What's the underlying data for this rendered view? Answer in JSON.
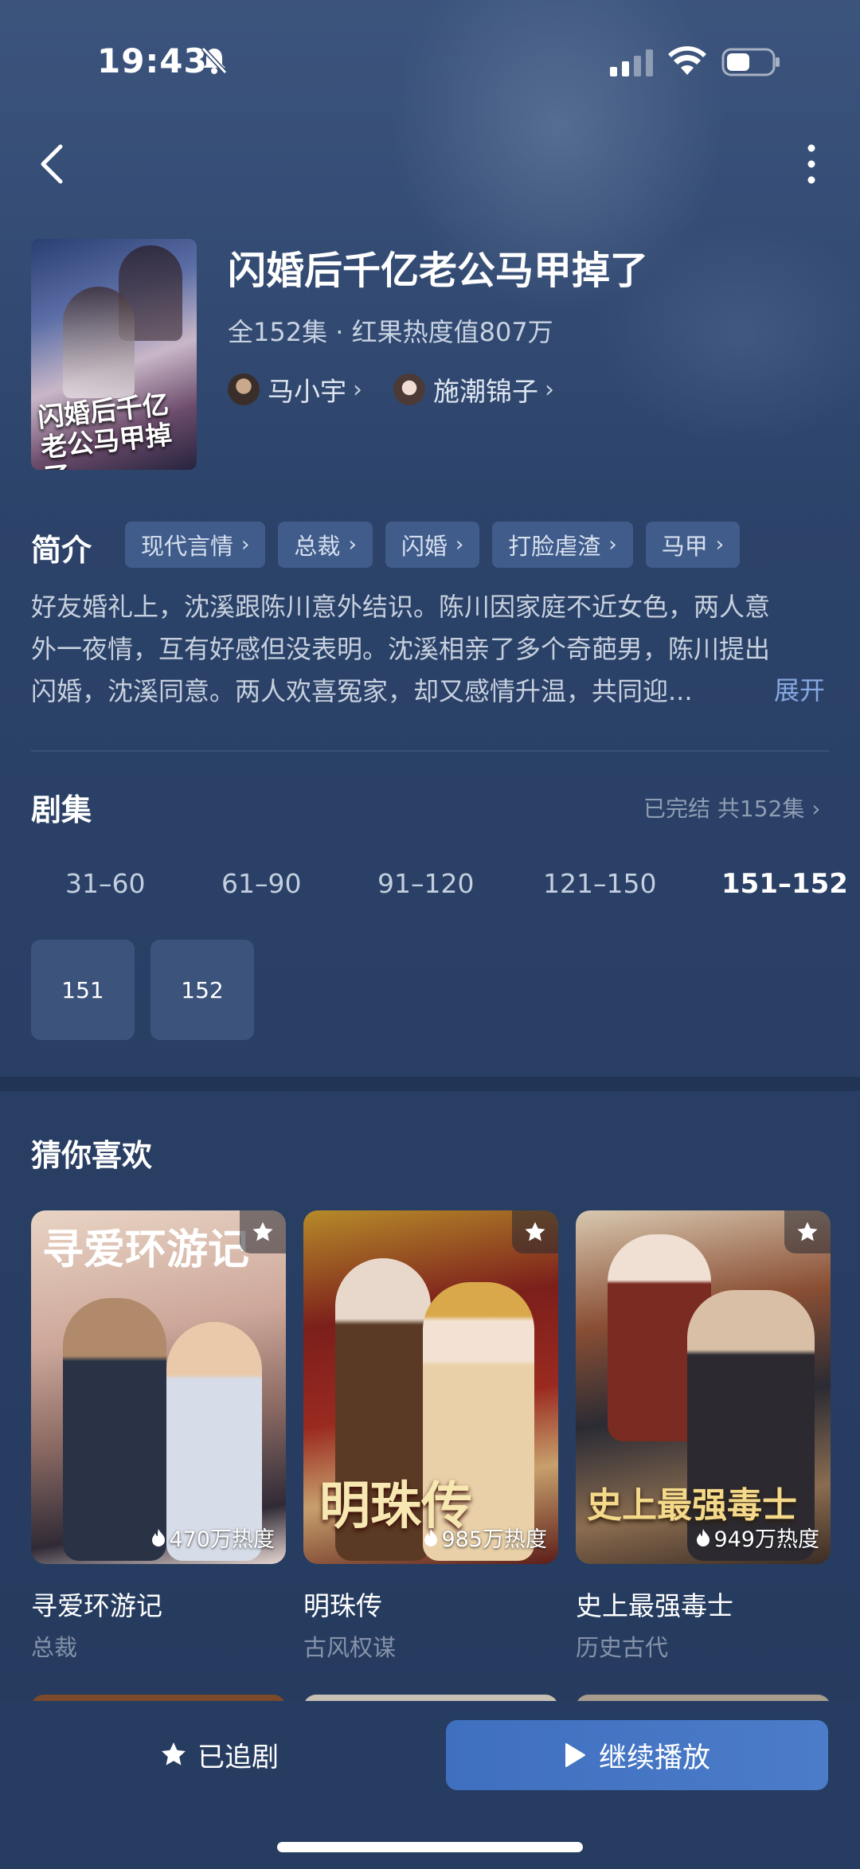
{
  "status_bar": {
    "time": "19:43"
  },
  "drama": {
    "title": "闪婚后千亿老公马甲掉了",
    "meta": "全152集 · 红果热度值807万",
    "cover_title": "闪婚后千亿老公马甲掉了",
    "actors": [
      {
        "name": "马小宇"
      },
      {
        "name": "施潮锦子"
      }
    ]
  },
  "intro": {
    "label": "简介",
    "tags": [
      "现代言情",
      "总裁",
      "闪婚",
      "打脸虐渣",
      "马甲"
    ],
    "synopsis_lines": [
      "好友婚礼上，沈溪跟陈川意外结识。陈川因家庭不近女色，两人意",
      "外一夜情，互有好感但没表明。沈溪相亲了多个奇葩男，陈川提出",
      "闪婚，沈溪同意。两人欢喜冤家，却又感情升温，共同迎..."
    ],
    "expand": "展开"
  },
  "episodes": {
    "label": "剧集",
    "status": "已完结 共152集 ›",
    "ranges": [
      "31–60",
      "61–90",
      "91–120",
      "121–150",
      "151–152"
    ],
    "active_range": "151–152",
    "items": [
      "151",
      "152"
    ]
  },
  "recommend": {
    "label": "猜你喜欢",
    "cards": [
      {
        "name": "寻爱环游记",
        "category": "总裁",
        "heat": "470万热度",
        "art": "寻爱环游记"
      },
      {
        "name": "明珠传",
        "category": "古风权谋",
        "heat": "985万热度",
        "art": "明珠传"
      },
      {
        "name": "史上最强毒士",
        "category": "历史古代",
        "heat": "949万热度",
        "art": "史上最强毒士"
      }
    ]
  },
  "bottom": {
    "follow_label": "已追剧",
    "play_label": "继续播放"
  },
  "colors": {
    "accent": "#4777c6",
    "link": "#86a8e0",
    "background": "#2c436a"
  }
}
